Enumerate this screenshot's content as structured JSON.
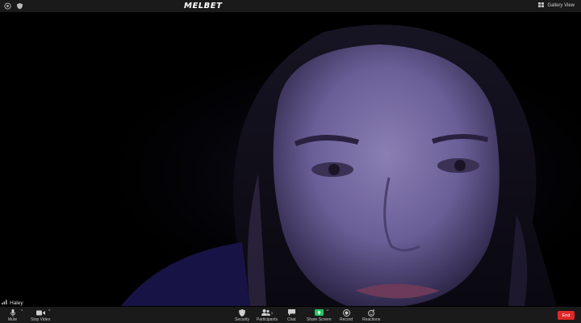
{
  "header": {
    "brand_watermark": "MELBET",
    "gallery_view_label": "Gallery View"
  },
  "participant": {
    "name": "Haley"
  },
  "toolbar": {
    "mute_label": "Mute",
    "stop_video_label": "Stop Video",
    "security_label": "Security",
    "participants_label": "Participants",
    "participants_count": "1",
    "chat_label": "Chat",
    "share_screen_label": "Share Screen",
    "record_label": "Record",
    "reactions_label": "Reactions",
    "end_label": "End"
  },
  "colors": {
    "end_button": "#e02828",
    "share_screen_accent": "#23c45e",
    "toolbar_bg": "#1a1a1a"
  }
}
